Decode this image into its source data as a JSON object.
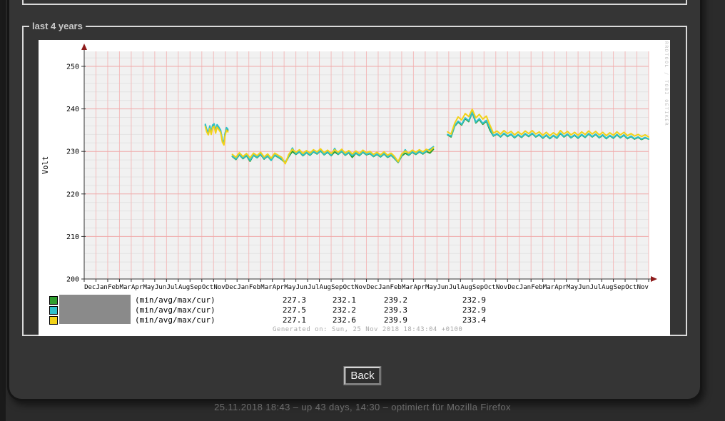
{
  "panel": {
    "legend_title": "last 4 years"
  },
  "back_button": {
    "label": "Back"
  },
  "footer": {
    "status": "25.11.2018 18:43 – up 43 days, 14:30 – optimiert für Mozilla Firefox"
  },
  "chart_data": {
    "type": "line",
    "title": "",
    "ylabel": "Volt",
    "ylim": [
      200,
      253.5
    ],
    "yticks": [
      200,
      210,
      220,
      230,
      240,
      250
    ],
    "month_labels": [
      "Dec",
      "Jan",
      "Feb",
      "Mar",
      "Apr",
      "May",
      "Jun",
      "Jul",
      "Aug",
      "Sep",
      "Oct",
      "Nov"
    ],
    "year_repeats": 4,
    "grid": {
      "major_color": "#efa9a9",
      "minor_color": "#e3e3e3",
      "month_color": "#f3bcbc",
      "plot_bg": "#f1f1f1"
    },
    "watermark": "RRDTOOL / TOBI OETIKER",
    "generated": "Generated on: Sun, 25 Nov 2018 18:43:04 +0100",
    "legend_rows": [
      {
        "color": "#2f9e2f",
        "label": "(min/avg/max/cur)",
        "min": "227.3",
        "avg": "232.1",
        "max": "239.2",
        "cur": "232.9"
      },
      {
        "color": "#2fc0cb",
        "label": "(min/avg/max/cur)",
        "min": "227.5",
        "avg": "232.2",
        "max": "239.3",
        "cur": "232.9"
      },
      {
        "color": "#f2d218",
        "label": "(min/avg/max/cur)",
        "min": "227.1",
        "avg": "232.6",
        "max": "239.9",
        "cur": "233.4"
      }
    ],
    "segments": [
      {
        "x": [
          10.3,
          10.42,
          10.55,
          10.68,
          10.8,
          10.92,
          11.05,
          11.18,
          11.3,
          11.45,
          11.6,
          11.75,
          11.88,
          11.97,
          12.1,
          12.22
        ]
      },
      {
        "x_start": 12.6,
        "x_step": 0.3,
        "count": 58
      },
      {
        "x_start": 30.9,
        "x_step": 0.3,
        "count": 58
      }
    ],
    "series": [
      {
        "name": "green",
        "color": "#2f9e2f",
        "values": [
          [
            236.2,
            235.0,
            234.2,
            235.8,
            234.3,
            236.0,
            236.3,
            234.7,
            236.1,
            235.5,
            234.8,
            232.6,
            231.8,
            234.0,
            235.4,
            235.0
          ],
          [
            228.8,
            228.1,
            229.2,
            228.3,
            229.0,
            227.7,
            229.1,
            228.5,
            229.3,
            228.2,
            228.9,
            227.9,
            229.1,
            228.6,
            228.1,
            227.3,
            228.8,
            230.0,
            229.3,
            229.9,
            229.0,
            229.7,
            229.1,
            229.9,
            229.4,
            230.1,
            229.2,
            229.8,
            229.0,
            229.9,
            229.3,
            230.0,
            229.1,
            229.7,
            228.6,
            229.6,
            229.0,
            229.8,
            229.2,
            229.5,
            228.8,
            229.3,
            228.7,
            229.4,
            228.6,
            229.1,
            228.3,
            227.4,
            228.9,
            229.6,
            229.1,
            229.8,
            229.3,
            229.9,
            229.4,
            230.0,
            229.6,
            230.5
          ],
          [
            233.9,
            233.4,
            235.9,
            236.9,
            236.2,
            237.7,
            237.0,
            239.2,
            236.7,
            237.5,
            236.4,
            237.1,
            235.0,
            233.6,
            234.1,
            233.4,
            234.2,
            233.5,
            234.0,
            233.2,
            233.9,
            233.3,
            234.1,
            233.5,
            234.2,
            233.4,
            233.9,
            233.1,
            233.8,
            233.0,
            233.7,
            233.1,
            234.2,
            233.4,
            234.0,
            233.2,
            233.8,
            233.1,
            233.9,
            233.3,
            234.1,
            233.4,
            234.0,
            233.2,
            233.8,
            233.0,
            233.7,
            233.1,
            233.9,
            233.2,
            233.8,
            233.0,
            233.5,
            232.9,
            233.3,
            232.8,
            233.2,
            232.9
          ]
        ]
      },
      {
        "name": "cyan",
        "color": "#2fc0cb",
        "values": [
          [
            236.4,
            235.2,
            234.4,
            236.0,
            234.5,
            236.2,
            236.5,
            234.9,
            236.3,
            235.7,
            235.0,
            232.8,
            232.0,
            234.2,
            235.6,
            235.2
          ],
          [
            228.9,
            228.2,
            229.3,
            228.4,
            229.1,
            227.9,
            229.2,
            228.6,
            229.4,
            228.3,
            229.0,
            227.9,
            229.2,
            228.7,
            228.2,
            227.5,
            228.9,
            230.8,
            229.4,
            230.0,
            229.1,
            229.8,
            229.2,
            230.0,
            229.5,
            230.2,
            229.3,
            229.9,
            229.1,
            230.7,
            229.4,
            230.1,
            229.2,
            229.8,
            229.0,
            229.7,
            229.1,
            229.9,
            229.3,
            229.6,
            228.9,
            229.4,
            228.8,
            229.5,
            228.7,
            229.2,
            228.4,
            227.5,
            229.0,
            230.4,
            229.2,
            229.9,
            229.4,
            230.0,
            229.5,
            230.1,
            230.5,
            231.1
          ],
          [
            234.0,
            233.6,
            236.0,
            237.1,
            236.4,
            237.9,
            237.2,
            239.3,
            236.9,
            237.7,
            236.6,
            237.3,
            235.4,
            233.7,
            234.2,
            233.5,
            234.3,
            233.6,
            234.1,
            233.3,
            234.0,
            233.4,
            234.2,
            233.6,
            234.3,
            233.5,
            234.0,
            233.2,
            233.9,
            233.1,
            233.8,
            233.2,
            234.3,
            233.5,
            234.1,
            233.3,
            233.9,
            233.2,
            234.0,
            233.4,
            234.2,
            233.5,
            234.1,
            233.3,
            233.9,
            233.1,
            233.8,
            233.2,
            234.0,
            233.3,
            233.9,
            233.1,
            233.6,
            233.0,
            233.4,
            232.9,
            233.3,
            232.9
          ]
        ]
      },
      {
        "name": "yellow",
        "color": "#f2d218",
        "values": [
          [
            235.8,
            234.6,
            233.9,
            235.4,
            234.0,
            235.6,
            235.9,
            234.3,
            235.7,
            235.1,
            234.5,
            232.2,
            231.5,
            233.6,
            235.0,
            234.6
          ],
          [
            229.3,
            228.6,
            229.7,
            228.8,
            229.5,
            228.5,
            229.6,
            229.0,
            229.8,
            228.7,
            229.4,
            228.4,
            229.6,
            229.1,
            228.6,
            227.1,
            229.3,
            230.5,
            229.8,
            230.4,
            229.5,
            230.2,
            229.6,
            230.4,
            229.9,
            230.6,
            229.7,
            230.3,
            229.5,
            230.4,
            229.8,
            230.5,
            229.6,
            230.2,
            229.4,
            230.1,
            229.5,
            230.3,
            229.7,
            230.0,
            229.3,
            229.8,
            229.2,
            229.9,
            229.1,
            229.6,
            228.8,
            227.6,
            229.4,
            230.1,
            229.6,
            230.3,
            229.8,
            230.4,
            229.9,
            230.5,
            230.1,
            230.9
          ],
          [
            234.6,
            234.1,
            236.6,
            238.1,
            237.4,
            238.9,
            238.2,
            239.9,
            237.9,
            238.7,
            237.6,
            238.3,
            236.2,
            234.3,
            234.8,
            234.1,
            234.9,
            234.2,
            234.7,
            233.9,
            234.6,
            234.0,
            234.8,
            234.2,
            234.9,
            234.1,
            234.6,
            233.8,
            234.5,
            233.7,
            234.4,
            233.8,
            234.9,
            234.1,
            234.7,
            233.9,
            234.5,
            233.8,
            234.6,
            234.0,
            234.8,
            234.1,
            234.7,
            233.9,
            234.5,
            233.7,
            234.4,
            233.8,
            234.6,
            233.9,
            234.5,
            233.7,
            234.2,
            233.6,
            234.0,
            233.5,
            233.9,
            233.4
          ]
        ]
      }
    ]
  }
}
